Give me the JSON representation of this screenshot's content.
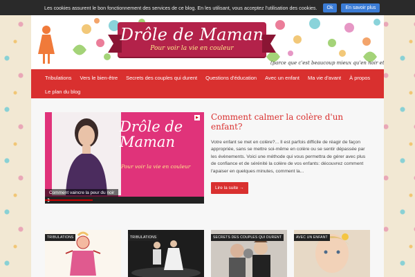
{
  "cookie_bar": {
    "message": "Les cookies assurent le bon fonctionnement des services de ce blog. En les utilisant, vous acceptez l'utilisation des cookies.",
    "ok_label": "Ok",
    "more_label": "En savoir plus"
  },
  "header": {
    "title": "Drôle de Maman",
    "subtitle": "Pour voir la vie en couleur",
    "tagline": "(parce que c'est beaucoup mieux qu'en noir et blanc)"
  },
  "nav": {
    "items": [
      {
        "label": "Tribulations"
      },
      {
        "label": "Vers le bien-être"
      },
      {
        "label": "Secrets des couples qui durent"
      },
      {
        "label": "Questions d'éducation"
      },
      {
        "label": "Avec un enfant"
      },
      {
        "label": "Ma vie d'avant"
      },
      {
        "label": "À propos"
      },
      {
        "label": "Le plan du blog"
      }
    ]
  },
  "featured": {
    "video_title_line1": "Drôle de",
    "video_title_line2": "Maman",
    "video_subtitle": "Pour voir la vie en couleur",
    "video_caption": "Comment vaincre la peur du noir",
    "video_progress": 0.3,
    "title": "Comment calmer la colère d'un enfant?",
    "excerpt": "Votre enfant se met en colère?... Il est parfois difficile de réagir de façon appropriée, sans se mettre soi-même en colère ou se sentir dépassée par les évènements. Voici une méthode qui vous permettra de gérer avec plus de confiance et de sérénité la colère de vos enfants: découvrez comment l'apaiser en quelques minutes, comment la...",
    "read_more": "Lire la suite →"
  },
  "cards": [
    {
      "tag": "TRIBULATIONS",
      "thumb": "cartoon-woman"
    },
    {
      "tag": "TRIBULATIONS",
      "thumb": "stage-scene"
    },
    {
      "tag": "SECRETS DES COUPLES QUI DURENT",
      "thumb": "boxing-couple"
    },
    {
      "tag": "AVEC UN ENFANT",
      "thumb": "child-portrait"
    }
  ],
  "colors": {
    "accent": "#d9302f",
    "brand": "#b3224a",
    "link": "#d9302f"
  }
}
